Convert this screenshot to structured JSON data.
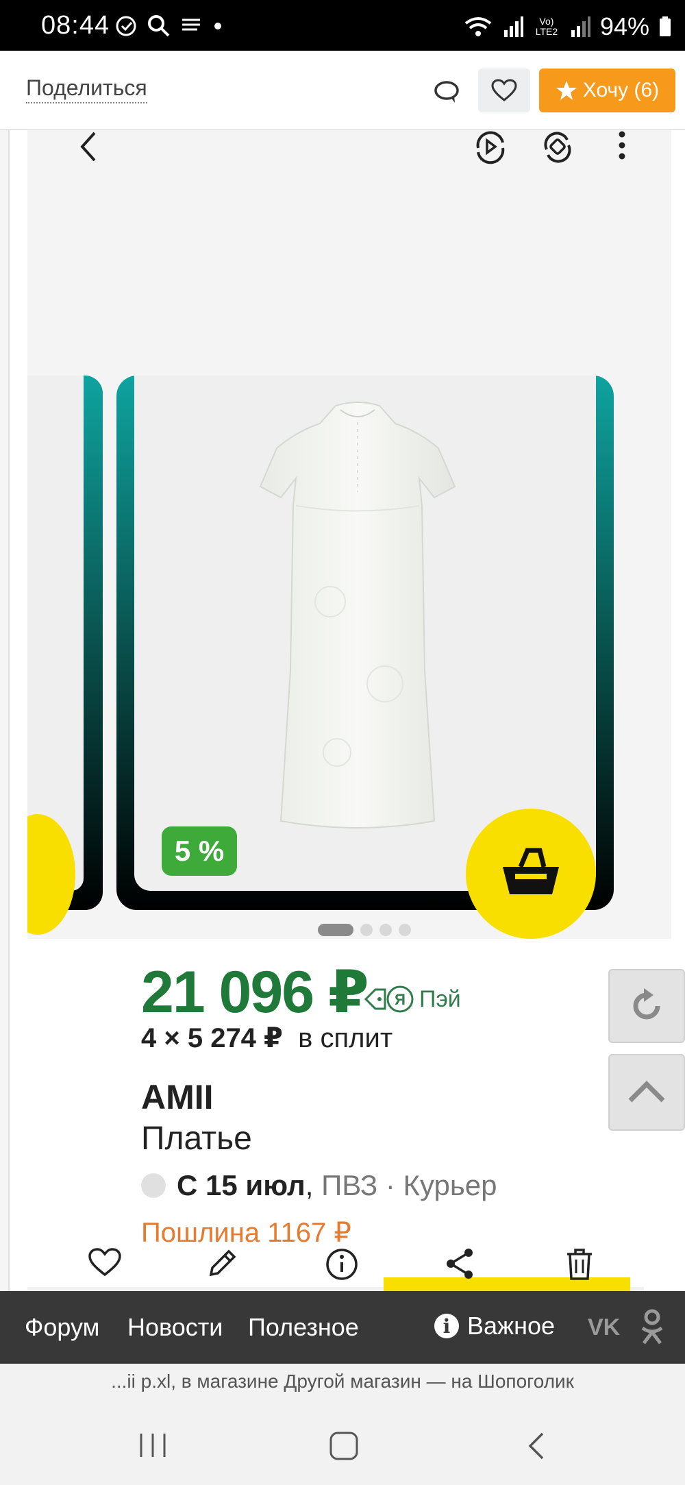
{
  "status_bar": {
    "time": "08:44",
    "network_label": "Vo) LTE2",
    "battery": "94%"
  },
  "header": {
    "share_label": "Поделиться",
    "want_label": "Хочу (6)"
  },
  "product": {
    "discount": "5 %",
    "price": "21 096 ₽",
    "pay_label": "Пэй",
    "split_amount": "4 × 5 274 ₽",
    "split_suffix": "в сплит",
    "brand": "AMII",
    "type": "Платье",
    "delivery_date": "С 15 июл",
    "delivery_rest": "ПВЗ · Курьер",
    "duty": "Пошлина 1167 ₽",
    "gallery_dots": 4,
    "active_dot": 0
  },
  "forum_nav": {
    "items": [
      "Форум",
      "Новости",
      "Полезное"
    ],
    "important": "Важное"
  },
  "page_title": "...ii p.xl, в магазине Другой магазин — на Шопоголик",
  "colors": {
    "price_green": "#1f7a3a",
    "want_orange": "#f79a1c",
    "market_yellow": "#f8df00",
    "discount_green": "#3daa3a",
    "duty_orange": "#e67a2e",
    "nav_dark": "#383838"
  }
}
